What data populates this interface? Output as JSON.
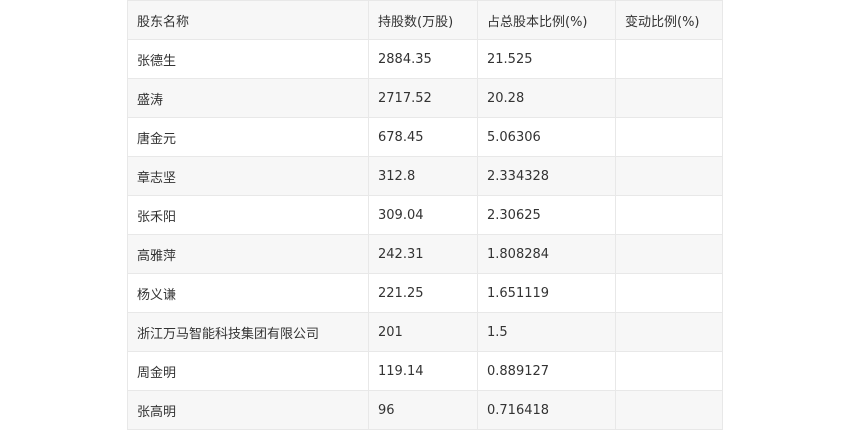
{
  "table": {
    "headers": [
      "股东名称",
      "持股数(万股)",
      "占总股本比例(%)",
      "变动比例(%)"
    ],
    "rows": [
      [
        "张德生",
        "2884.35",
        "21.525",
        ""
      ],
      [
        "盛涛",
        "2717.52",
        "20.28",
        ""
      ],
      [
        "唐金元",
        "678.45",
        "5.06306",
        ""
      ],
      [
        "章志坚",
        "312.8",
        "2.334328",
        ""
      ],
      [
        "张禾阳",
        "309.04",
        "2.30625",
        ""
      ],
      [
        "高雅萍",
        "242.31",
        "1.808284",
        ""
      ],
      [
        "杨义谦",
        "221.25",
        "1.651119",
        ""
      ],
      [
        "浙江万马智能科技集团有限公司",
        "201",
        "1.5",
        ""
      ],
      [
        "周金明",
        "119.14",
        "0.889127",
        ""
      ],
      [
        "张高明",
        "96",
        "0.716418",
        ""
      ]
    ]
  }
}
